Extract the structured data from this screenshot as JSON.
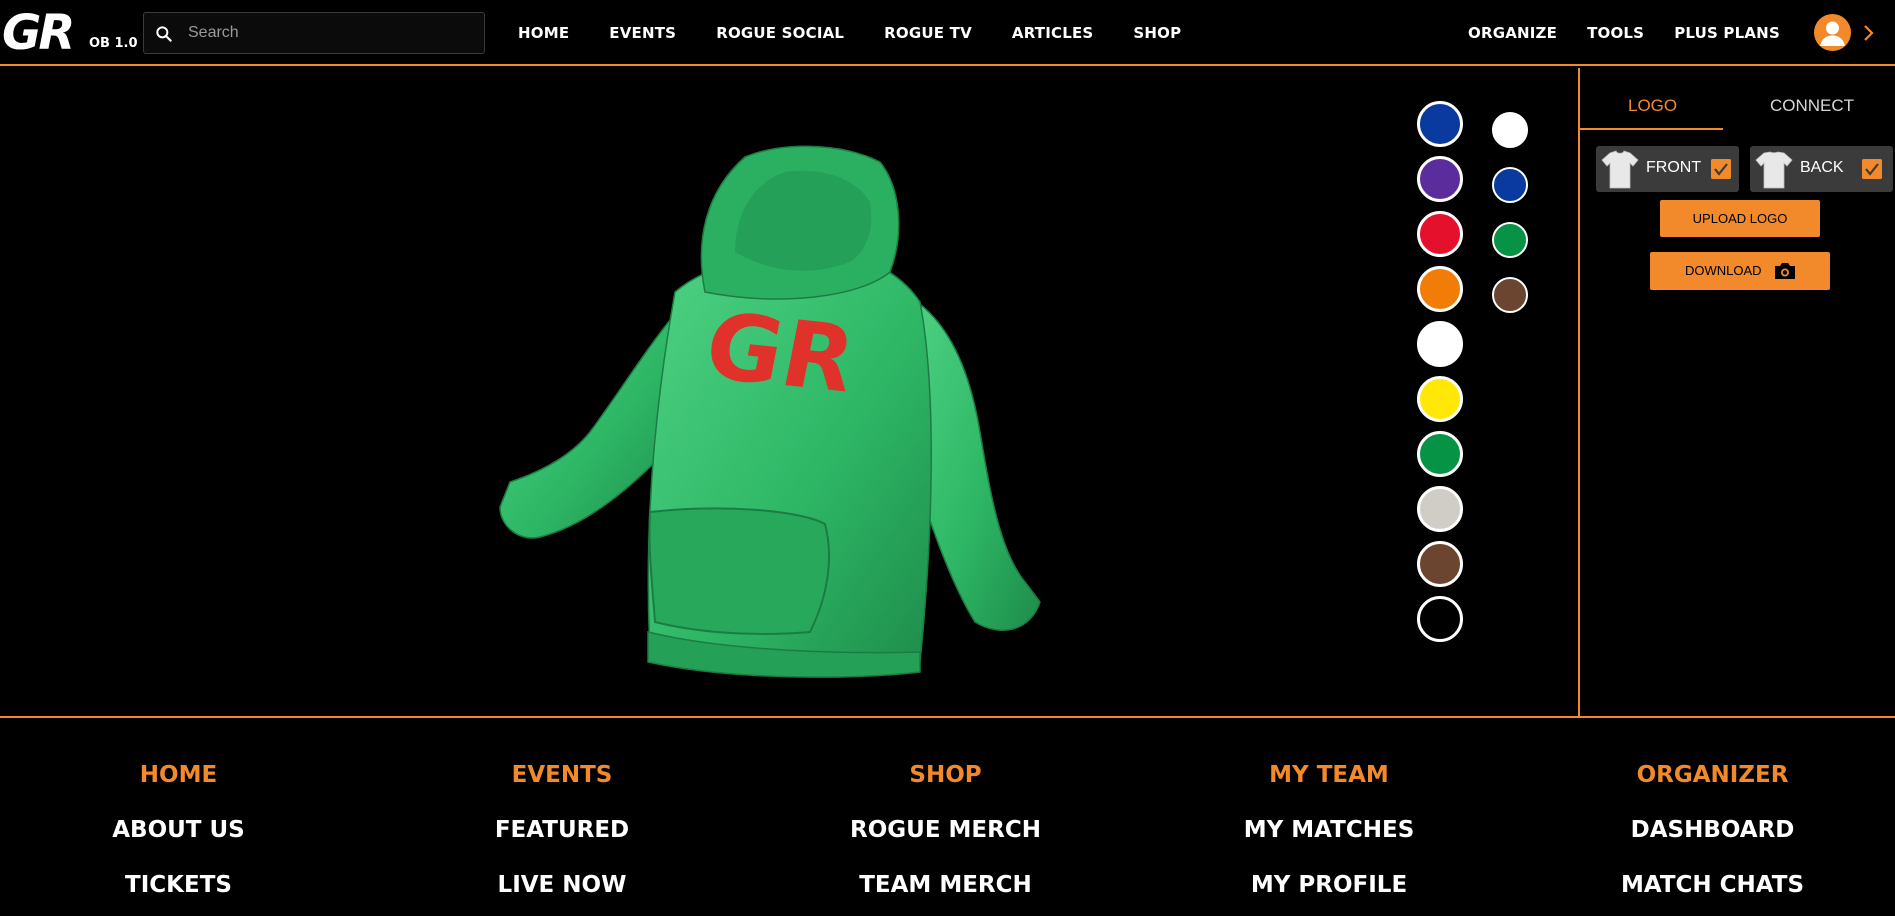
{
  "header": {
    "logo_text": "GR",
    "version": "OB 1.0",
    "search": {
      "placeholder": "Search"
    },
    "nav_left": [
      "HOME",
      "EVENTS",
      "ROGUE SOCIAL",
      "ROGUE TV",
      "ARTICLES",
      "SHOP"
    ],
    "nav_right": [
      "ORGANIZE",
      "TOOLS",
      "PLUS PLANS"
    ]
  },
  "viewer": {
    "product_logo_text": "GR",
    "product_color": "#2eb866",
    "product_logo_color": "#e0312a",
    "carousel": {
      "count": 4,
      "active_index": 0
    },
    "primary_colors": [
      "#0a3aa0",
      "#5b2d9c",
      "#e5102c",
      "#f27c08",
      "#ffffff",
      "#ffe808",
      "#069346",
      "#cfcdc6",
      "#6b4530",
      "#000000"
    ],
    "secondary_colors": [
      "#ffffff",
      "#0a3aa0",
      "#069346",
      "#6b4530"
    ]
  },
  "panel": {
    "tabs": {
      "logo": "LOGO",
      "connect": "CONNECT"
    },
    "front_label": "FRONT",
    "back_label": "BACK",
    "front_checked": true,
    "back_checked": true,
    "upload_label": "UPLOAD LOGO",
    "download_label": "DOWNLOAD"
  },
  "footer": {
    "columns": [
      {
        "heading": "HOME",
        "links": [
          "ABOUT US",
          "TICKETS"
        ]
      },
      {
        "heading": "EVENTS",
        "links": [
          "FEATURED",
          "LIVE NOW"
        ]
      },
      {
        "heading": "SHOP",
        "links": [
          "ROGUE MERCH",
          "TEAM MERCH"
        ]
      },
      {
        "heading": "MY TEAM",
        "links": [
          "MY MATCHES",
          "MY PROFILE"
        ]
      },
      {
        "heading": "ORGANIZER",
        "links": [
          "DASHBOARD",
          "MATCH CHATS"
        ]
      }
    ]
  },
  "colors": {
    "accent": "#f2892a"
  }
}
